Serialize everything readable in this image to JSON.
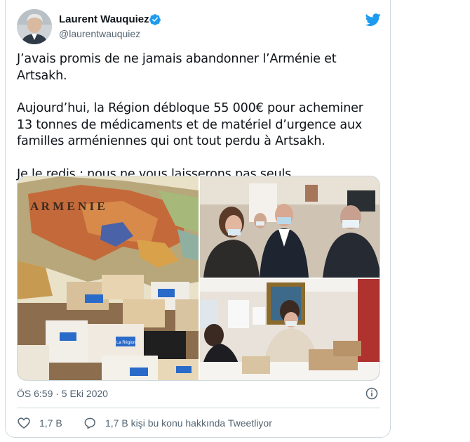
{
  "author": {
    "name": "Laurent Wauquiez",
    "handle": "@laurentwauquiez",
    "verified": true
  },
  "tweet": {
    "paragraphs": [
      "J’avais promis de ne jamais abandonner l’Arménie et Artsakh.",
      "Aujourd’hui, la Région débloque 55 000€ pour acheminer 13 tonnes de médicaments et de matériel d’urgence aux familles arméniennes qui ont tout perdu à Artsakh.",
      "Je le redis : nous ne vous laisserons pas seuls."
    ]
  },
  "media": {
    "map_label": "A R M E N I E",
    "box_label": "La Région"
  },
  "meta": {
    "timestamp": "ÖS 6:59 · 5 Eki 2020"
  },
  "actions": {
    "like_count": "1,7 B",
    "reply_text": "1,7 B kişi bu konu hakkında Tweetliyor"
  },
  "colors": {
    "brand_blue": "#1d9bf0",
    "muted_text": "#536471",
    "border": "#cfd9de"
  },
  "icons": [
    "verified-badge-icon",
    "twitter-bird-icon",
    "info-icon",
    "heart-icon",
    "reply-bubble-icon"
  ]
}
